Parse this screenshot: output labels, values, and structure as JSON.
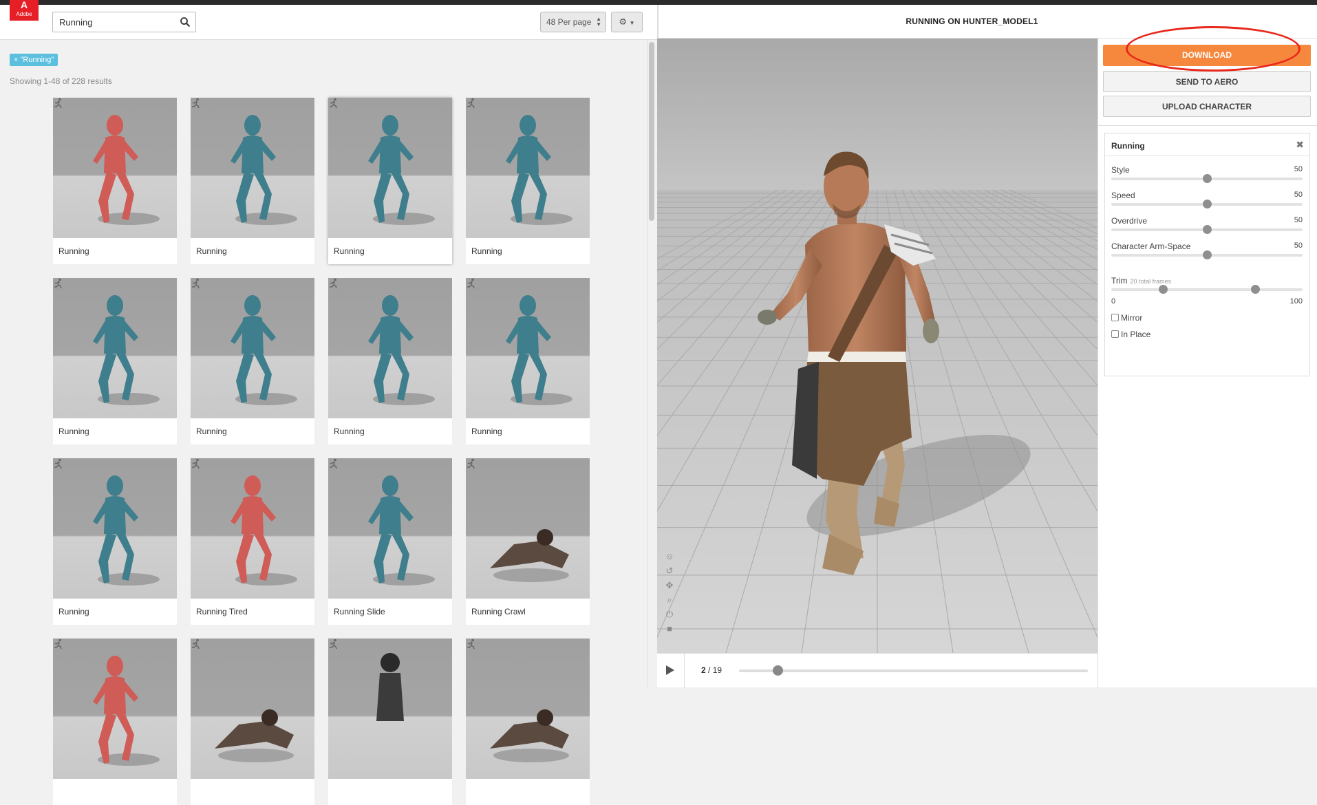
{
  "app": {
    "logo_label": "Adobe"
  },
  "search": {
    "value": "Running",
    "placeholder": "Search"
  },
  "toolbar": {
    "per_page": "48 Per page",
    "settings_icon": "gear-icon"
  },
  "filter_tag": "× \"Running\"",
  "results_text": "Showing 1-48 of 228 results",
  "cards": [
    {
      "label": "Running",
      "figure": "red-mannequin"
    },
    {
      "label": "Running",
      "figure": "teal-mannequin"
    },
    {
      "label": "Running",
      "figure": "teal-mannequin"
    },
    {
      "label": "Running",
      "figure": "teal-mannequin"
    },
    {
      "label": "Running",
      "figure": "teal-mannequin"
    },
    {
      "label": "Running",
      "figure": "teal-mannequin"
    },
    {
      "label": "Running",
      "figure": "teal-mannequin"
    },
    {
      "label": "Running",
      "figure": "teal-mannequin"
    },
    {
      "label": "Running",
      "figure": "teal-mannequin"
    },
    {
      "label": "Running Tired",
      "figure": "red-mannequin"
    },
    {
      "label": "Running Slide",
      "figure": "teal-mannequin"
    },
    {
      "label": "Running Crawl",
      "figure": "zombie"
    },
    {
      "label": "",
      "figure": "red-mannequin"
    },
    {
      "label": "",
      "figure": "zombie"
    },
    {
      "label": "",
      "figure": "woman"
    },
    {
      "label": "",
      "figure": "zombie"
    }
  ],
  "viewer": {
    "title": "RUNNING ON HUNTER_MODEL1",
    "frame_current": "2",
    "frame_total": "/ 19",
    "playhead_fraction": 0.11
  },
  "actions": {
    "download": "DOWNLOAD",
    "send_to_aero": "SEND TO AERO",
    "upload_character": "UPLOAD CHARACTER"
  },
  "panel": {
    "title": "Running",
    "params": [
      {
        "label": "Style",
        "value": "50",
        "fraction": 0.5
      },
      {
        "label": "Speed",
        "value": "50",
        "fraction": 0.5
      },
      {
        "label": "Overdrive",
        "value": "50",
        "fraction": 0.5
      },
      {
        "label": "Character Arm-Space",
        "value": "50",
        "fraction": 0.5
      }
    ],
    "trim": {
      "label": "Trim",
      "sub": "20 total frames",
      "min": "0",
      "max": "100",
      "low_fraction": 0.27,
      "high_fraction": 0.75
    },
    "mirror": "Mirror",
    "in_place": "In Place"
  },
  "colors": {
    "accent": "#f5883c",
    "tag": "#5bc0de",
    "annotation": "#e8281b",
    "mannequin_teal": "#3f7e8c",
    "mannequin_red": "#cf5c56"
  }
}
